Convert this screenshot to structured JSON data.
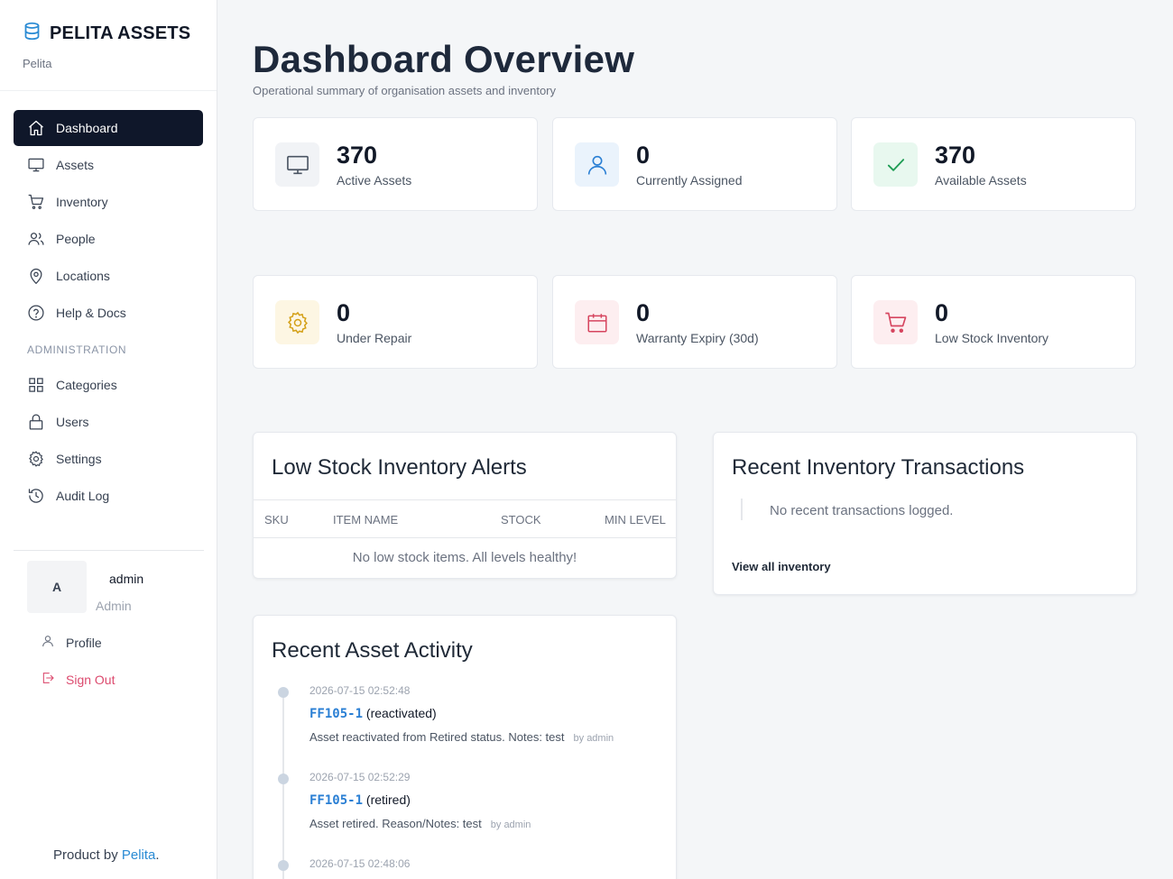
{
  "brand": {
    "title": "PELITA ASSETS",
    "subtitle": "Pelita"
  },
  "nav": {
    "items": [
      {
        "label": "Dashboard"
      },
      {
        "label": "Assets"
      },
      {
        "label": "Inventory"
      },
      {
        "label": "People"
      },
      {
        "label": "Locations"
      },
      {
        "label": "Help & Docs"
      }
    ],
    "admin_section": "ADMINISTRATION",
    "admin_items": [
      {
        "label": "Categories"
      },
      {
        "label": "Users"
      },
      {
        "label": "Settings"
      },
      {
        "label": "Audit Log"
      }
    ]
  },
  "user": {
    "initial": "A",
    "name": "admin",
    "role": "Admin",
    "profile_label": "Profile",
    "signout_label": "Sign Out"
  },
  "footer": {
    "prefix": "Product by ",
    "link": "Pelita",
    "suffix": "."
  },
  "header": {
    "title": "Dashboard Overview",
    "subtitle": "Operational summary of organisation assets and inventory"
  },
  "stats": [
    {
      "value": "370",
      "label": "Active Assets",
      "icon": "monitor-icon"
    },
    {
      "value": "0",
      "label": "Currently Assigned",
      "icon": "user-icon"
    },
    {
      "value": "370",
      "label": "Available Assets",
      "icon": "check-icon"
    },
    {
      "value": "0",
      "label": "Under Repair",
      "icon": "gear-icon"
    },
    {
      "value": "0",
      "label": "Warranty Expiry (30d)",
      "icon": "calendar-icon"
    },
    {
      "value": "0",
      "label": "Low Stock Inventory",
      "icon": "cart-icon"
    }
  ],
  "low_stock": {
    "title": "Low Stock Inventory Alerts",
    "columns": [
      "SKU",
      "ITEM NAME",
      "STOCK",
      "MIN LEVEL"
    ],
    "empty": "No low stock items. All levels healthy!"
  },
  "transactions": {
    "title": "Recent Inventory Transactions",
    "empty": "No recent transactions logged.",
    "view_all": "View all inventory"
  },
  "activity": {
    "title": "Recent Asset Activity",
    "items": [
      {
        "time": "2026-07-15 02:52:48",
        "code": "FF105-1",
        "action": "(reactivated)",
        "desc": "Asset reactivated from Retired status. Notes: test",
        "by": "by admin"
      },
      {
        "time": "2026-07-15 02:52:29",
        "code": "FF105-1",
        "action": "(retired)",
        "desc": "Asset retired. Reason/Notes: test",
        "by": "by admin"
      },
      {
        "time": "2026-07-15 02:48:06"
      }
    ]
  }
}
